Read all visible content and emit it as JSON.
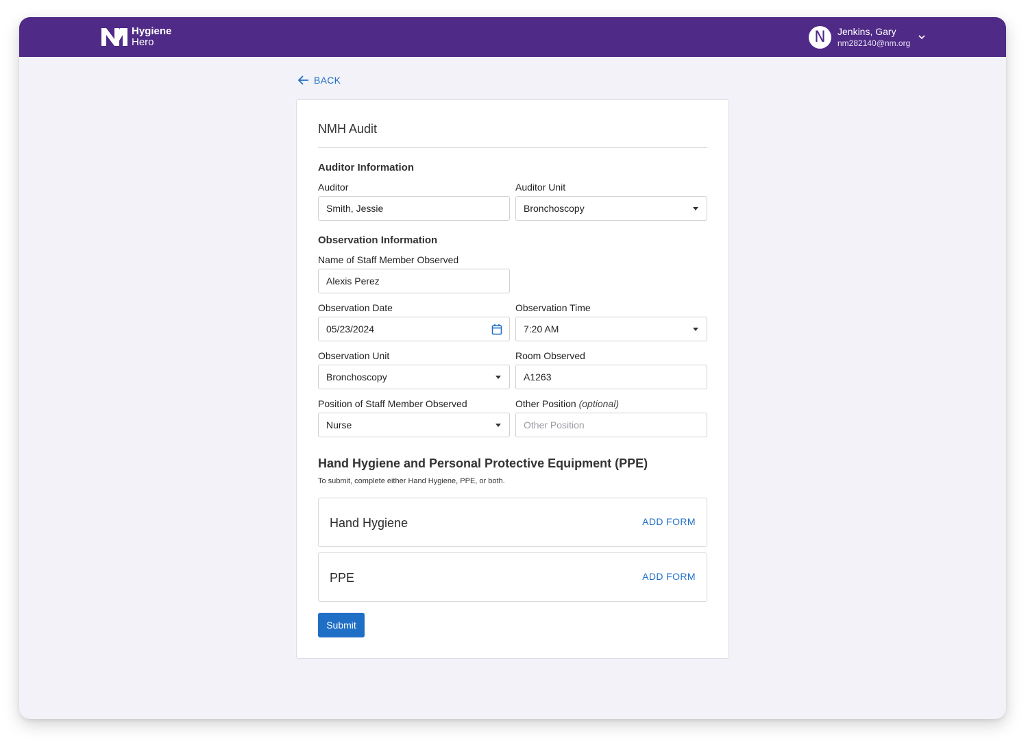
{
  "app": {
    "logo_line1": "Hygiene",
    "logo_line2": "Hero",
    "brand_color": "#4f2a86",
    "accent_color": "#1f6fc7"
  },
  "user": {
    "initial": "N",
    "name": "Jenkins, Gary",
    "email": "nm282140@nm.org"
  },
  "nav": {
    "back_label": "BACK"
  },
  "form": {
    "title": "NMH Audit",
    "auditor_section": {
      "heading": "Auditor Information",
      "auditor_label": "Auditor",
      "auditor_value": "Smith, Jessie",
      "unit_label": "Auditor Unit",
      "unit_value": "Bronchoscopy"
    },
    "observation_section": {
      "heading": "Observation Information",
      "staff_name_label": "Name of Staff Member Observed",
      "staff_name_value": "Alexis Perez",
      "date_label": "Observation Date",
      "date_value": "05/23/2024",
      "time_label": "Observation Time",
      "time_value": "7:20 AM",
      "unit_label": "Observation Unit",
      "unit_value": "Bronchoscopy",
      "room_label": "Room Observed",
      "room_value": "A1263",
      "position_label": "Position of Staff Member Observed",
      "position_value": "Nurse",
      "other_position_label": "Other Position",
      "other_position_optional": "(optional)",
      "other_position_placeholder": "Other Position",
      "other_position_value": ""
    },
    "hygiene_section": {
      "heading": "Hand Hygiene and Personal Protective Equipment (PPE)",
      "subtext": "To submit, complete either Hand Hygiene, PPE, or both.",
      "forms": [
        {
          "name": "Hand Hygiene",
          "action": "ADD FORM"
        },
        {
          "name": "PPE",
          "action": "ADD FORM"
        }
      ]
    },
    "submit_label": "Submit"
  },
  "icons": [
    "nm-logo-icon",
    "avatar",
    "chevron-down-icon",
    "arrow-left-icon",
    "calendar-icon",
    "dropdown-caret-icon"
  ]
}
